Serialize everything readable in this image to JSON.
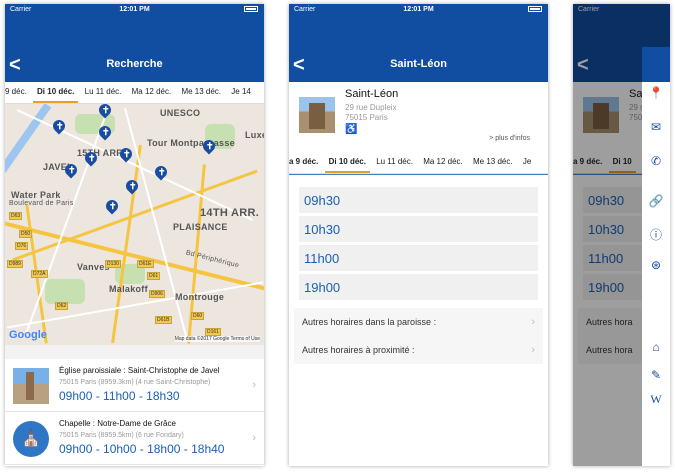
{
  "status": {
    "carrier": "Carrier",
    "time": "12:01 PM"
  },
  "screen1": {
    "back": "<",
    "title": "Recherche",
    "dates": [
      "9 déc.",
      "Di 10 déc.",
      "Lu 11 déc.",
      "Ma 12 déc.",
      "Me 13 déc.",
      "Je 14"
    ],
    "selected_date_index": 1,
    "map": {
      "labels": [
        "UNESCO",
        "Tour Montparnasse",
        "15TH ARR.",
        "14TH ARR.",
        "PLAISANCE",
        "Vanves",
        "Malakoff",
        "Montrouge",
        "Water Park",
        "JAVEL",
        "Luxe"
      ],
      "small_labels": [
        "Boulevard de Paris",
        "Bd Périphérique"
      ],
      "routes": [
        "D63",
        "D50",
        "D76",
        "D989",
        "D72A",
        "D130",
        "D61E",
        "D61",
        "D906",
        "D62",
        "D61B",
        "D60",
        "D161"
      ],
      "google": "Google",
      "copyright": "Map data ©2017 Google   Terms of Use"
    },
    "results": [
      {
        "title": "Église paroissiale : Saint-Christophe de Javel",
        "sub": "75015 Paris (8959.3km) (4 rue Saint-Christophe)",
        "times": "09h00 - 11h00 - 18h30"
      },
      {
        "title": "Chapelle : Notre-Dame de Grâce",
        "sub": "75015 Paris (8959.5km) (6 rue Fondary)",
        "times": "09h00 - 10h00 - 18h00 - 18h40"
      }
    ]
  },
  "screen2": {
    "back": "<",
    "title": "Saint-Léon",
    "church": {
      "name": "Saint-Léon",
      "address1": "29 rue Dupleix",
      "address2": "75015 Paris",
      "accessibility": "♿",
      "more": "> plus d'infos"
    },
    "dates": [
      "a 9 déc.",
      "Di 10 déc.",
      "Lu 11 déc.",
      "Ma 12 déc.",
      "Me 13 déc.",
      "Je"
    ],
    "selected_date_index": 1,
    "slots": [
      "09h30",
      "10h30",
      "11h00",
      "19h00"
    ],
    "links": [
      "Autres horaires dans la paroisse :",
      "Autres horaires à proximité :"
    ]
  },
  "screen3": {
    "back": "<",
    "name_partial": "Sai",
    "addr_partial1": "29 r",
    "addr_partial2": "7501",
    "dates": [
      "a 9 déc.",
      "Di 10"
    ],
    "selected_date_index": 1,
    "slots": [
      "09h30",
      "10h30",
      "11h00",
      "19h00"
    ],
    "links": [
      "Autres hora",
      "Autres hora"
    ],
    "drawer_icons": [
      "location-icon",
      "mail-icon",
      "phone-icon",
      "link-icon",
      "info-icon",
      "lifebuoy-icon",
      "home-icon",
      "edit-icon",
      "wikipedia-icon"
    ],
    "drawer_wiki": "W"
  },
  "colors": {
    "primary": "#114da0",
    "accent": "#e5a122",
    "time_blue": "#1a5fb4"
  }
}
